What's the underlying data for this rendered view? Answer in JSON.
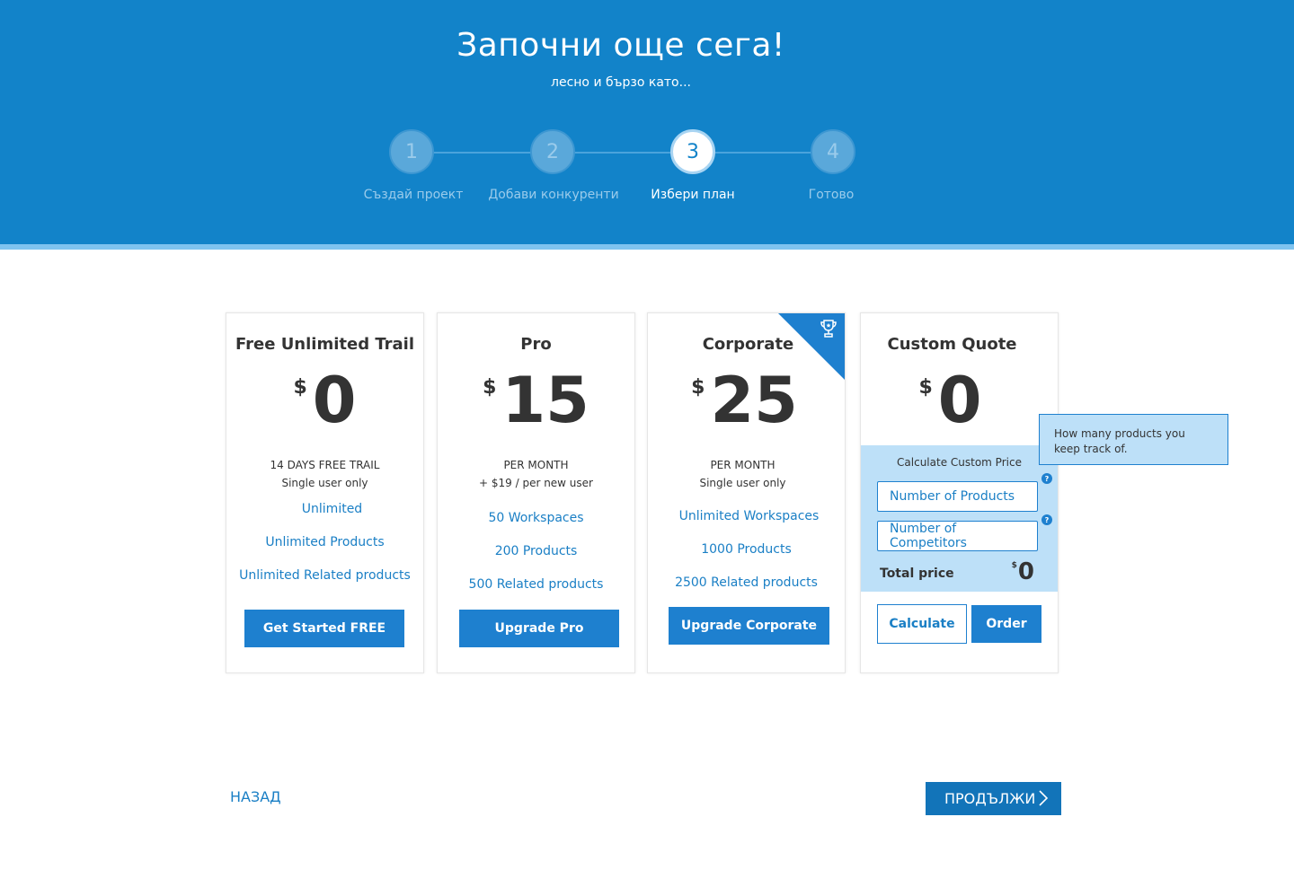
{
  "header": {
    "title": "Започни още сега!",
    "subtitle": "лесно и бързо като..."
  },
  "steps": [
    {
      "number": "1",
      "label": "Създай проект"
    },
    {
      "number": "2",
      "label": "Добави конкуренти"
    },
    {
      "number": "3",
      "label": "Избери план"
    },
    {
      "number": "4",
      "label": "Готово"
    }
  ],
  "plans": {
    "free": {
      "title": "Free Unlimited Trail",
      "currency": "$",
      "price": "0",
      "line1": "14  DAYS FREE TRAIL",
      "line2": "Single user only",
      "features": [
        "Unlimited",
        "Unlimited Products",
        "Unlimited Related products"
      ],
      "button": "Get Started FREE"
    },
    "pro": {
      "title": "Pro",
      "currency": "$",
      "price": "15",
      "line1": "PER MONTH",
      "line2": "+ $19 / per new user",
      "features": [
        "50  Workspaces",
        "200  Products",
        "500  Related products"
      ],
      "button": "Upgrade Pro"
    },
    "corporate": {
      "title": "Corporate",
      "currency": "$",
      "price": "25",
      "line1": "PER MONTH",
      "line2": "Single user only",
      "features": [
        "Unlimited  Workspaces",
        "1000  Products",
        "2500  Related products"
      ],
      "button": "Upgrade Corporate",
      "badge_icon": "trophy-icon"
    },
    "custom": {
      "title": "Custom Quote",
      "currency": "$",
      "price": "0",
      "calc_title": "Calculate Custom Price",
      "products_placeholder": "Number of Products",
      "competitors_placeholder": "Number of Competitors",
      "help": "?",
      "total_label": "Total price",
      "total_currency": "$",
      "total_value": "0",
      "calculate_button": "Calculate",
      "order_button": "Order"
    }
  },
  "tooltip": "How many products you keep track of.",
  "nav": {
    "back": "НАЗАД",
    "next": "ПРОДЪЛЖИ"
  },
  "colors": {
    "brand_blue": "#1283c9",
    "button_blue": "#1e80cf",
    "light_blue": "#bde0f8"
  }
}
